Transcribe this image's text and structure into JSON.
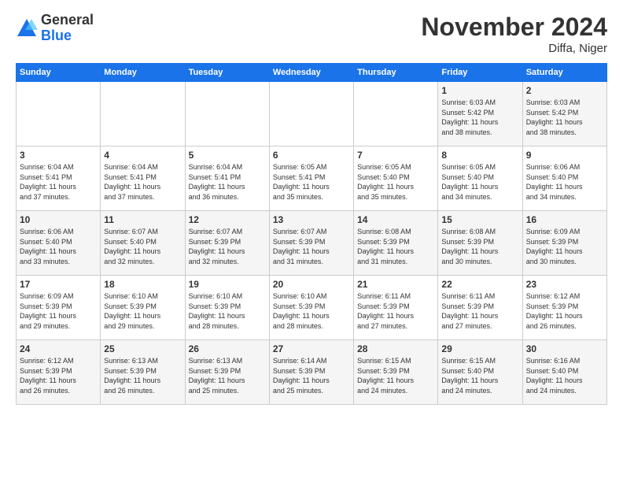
{
  "logo": {
    "general": "General",
    "blue": "Blue"
  },
  "title": "November 2024",
  "location": "Diffa, Niger",
  "days_of_week": [
    "Sunday",
    "Monday",
    "Tuesday",
    "Wednesday",
    "Thursday",
    "Friday",
    "Saturday"
  ],
  "weeks": [
    [
      {
        "day": "",
        "info": ""
      },
      {
        "day": "",
        "info": ""
      },
      {
        "day": "",
        "info": ""
      },
      {
        "day": "",
        "info": ""
      },
      {
        "day": "",
        "info": ""
      },
      {
        "day": "1",
        "info": "Sunrise: 6:03 AM\nSunset: 5:42 PM\nDaylight: 11 hours\nand 38 minutes."
      },
      {
        "day": "2",
        "info": "Sunrise: 6:03 AM\nSunset: 5:42 PM\nDaylight: 11 hours\nand 38 minutes."
      }
    ],
    [
      {
        "day": "3",
        "info": "Sunrise: 6:04 AM\nSunset: 5:41 PM\nDaylight: 11 hours\nand 37 minutes."
      },
      {
        "day": "4",
        "info": "Sunrise: 6:04 AM\nSunset: 5:41 PM\nDaylight: 11 hours\nand 37 minutes."
      },
      {
        "day": "5",
        "info": "Sunrise: 6:04 AM\nSunset: 5:41 PM\nDaylight: 11 hours\nand 36 minutes."
      },
      {
        "day": "6",
        "info": "Sunrise: 6:05 AM\nSunset: 5:41 PM\nDaylight: 11 hours\nand 35 minutes."
      },
      {
        "day": "7",
        "info": "Sunrise: 6:05 AM\nSunset: 5:40 PM\nDaylight: 11 hours\nand 35 minutes."
      },
      {
        "day": "8",
        "info": "Sunrise: 6:05 AM\nSunset: 5:40 PM\nDaylight: 11 hours\nand 34 minutes."
      },
      {
        "day": "9",
        "info": "Sunrise: 6:06 AM\nSunset: 5:40 PM\nDaylight: 11 hours\nand 34 minutes."
      }
    ],
    [
      {
        "day": "10",
        "info": "Sunrise: 6:06 AM\nSunset: 5:40 PM\nDaylight: 11 hours\nand 33 minutes."
      },
      {
        "day": "11",
        "info": "Sunrise: 6:07 AM\nSunset: 5:40 PM\nDaylight: 11 hours\nand 32 minutes."
      },
      {
        "day": "12",
        "info": "Sunrise: 6:07 AM\nSunset: 5:39 PM\nDaylight: 11 hours\nand 32 minutes."
      },
      {
        "day": "13",
        "info": "Sunrise: 6:07 AM\nSunset: 5:39 PM\nDaylight: 11 hours\nand 31 minutes."
      },
      {
        "day": "14",
        "info": "Sunrise: 6:08 AM\nSunset: 5:39 PM\nDaylight: 11 hours\nand 31 minutes."
      },
      {
        "day": "15",
        "info": "Sunrise: 6:08 AM\nSunset: 5:39 PM\nDaylight: 11 hours\nand 30 minutes."
      },
      {
        "day": "16",
        "info": "Sunrise: 6:09 AM\nSunset: 5:39 PM\nDaylight: 11 hours\nand 30 minutes."
      }
    ],
    [
      {
        "day": "17",
        "info": "Sunrise: 6:09 AM\nSunset: 5:39 PM\nDaylight: 11 hours\nand 29 minutes."
      },
      {
        "day": "18",
        "info": "Sunrise: 6:10 AM\nSunset: 5:39 PM\nDaylight: 11 hours\nand 29 minutes."
      },
      {
        "day": "19",
        "info": "Sunrise: 6:10 AM\nSunset: 5:39 PM\nDaylight: 11 hours\nand 28 minutes."
      },
      {
        "day": "20",
        "info": "Sunrise: 6:10 AM\nSunset: 5:39 PM\nDaylight: 11 hours\nand 28 minutes."
      },
      {
        "day": "21",
        "info": "Sunrise: 6:11 AM\nSunset: 5:39 PM\nDaylight: 11 hours\nand 27 minutes."
      },
      {
        "day": "22",
        "info": "Sunrise: 6:11 AM\nSunset: 5:39 PM\nDaylight: 11 hours\nand 27 minutes."
      },
      {
        "day": "23",
        "info": "Sunrise: 6:12 AM\nSunset: 5:39 PM\nDaylight: 11 hours\nand 26 minutes."
      }
    ],
    [
      {
        "day": "24",
        "info": "Sunrise: 6:12 AM\nSunset: 5:39 PM\nDaylight: 11 hours\nand 26 minutes."
      },
      {
        "day": "25",
        "info": "Sunrise: 6:13 AM\nSunset: 5:39 PM\nDaylight: 11 hours\nand 26 minutes."
      },
      {
        "day": "26",
        "info": "Sunrise: 6:13 AM\nSunset: 5:39 PM\nDaylight: 11 hours\nand 25 minutes."
      },
      {
        "day": "27",
        "info": "Sunrise: 6:14 AM\nSunset: 5:39 PM\nDaylight: 11 hours\nand 25 minutes."
      },
      {
        "day": "28",
        "info": "Sunrise: 6:15 AM\nSunset: 5:39 PM\nDaylight: 11 hours\nand 24 minutes."
      },
      {
        "day": "29",
        "info": "Sunrise: 6:15 AM\nSunset: 5:40 PM\nDaylight: 11 hours\nand 24 minutes."
      },
      {
        "day": "30",
        "info": "Sunrise: 6:16 AM\nSunset: 5:40 PM\nDaylight: 11 hours\nand 24 minutes."
      }
    ]
  ]
}
